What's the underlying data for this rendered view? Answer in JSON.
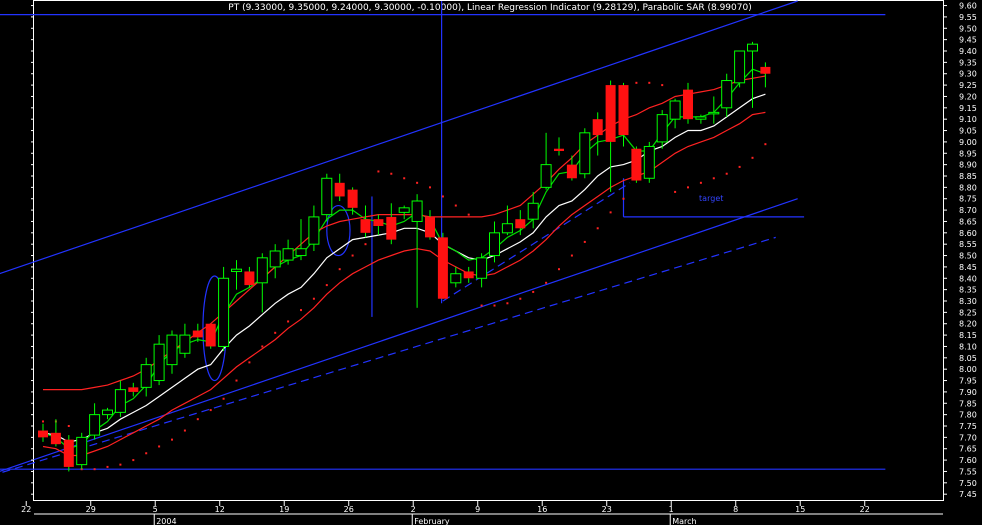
{
  "header": {
    "title": "PT (9.33000, 9.35000, 9.24000, 9.30000, -0.10000), Linear Regression Indicator (9.28129), Parabolic SAR (8.99070)"
  },
  "chart_data": {
    "type": "candlestick",
    "title": "PT (9.33000, 9.35000, 9.24000, 9.30000, -0.10000), Linear Regression Indicator (9.28129), Parabolic SAR (8.99070)",
    "ylim": [
      7.42,
      9.62
    ],
    "y_ticks": [
      "9.60",
      "9.55",
      "9.50",
      "9.45",
      "9.40",
      "9.35",
      "9.30",
      "9.25",
      "9.20",
      "9.15",
      "9.10",
      "9.05",
      "9.00",
      "8.95",
      "8.90",
      "8.85",
      "8.80",
      "8.75",
      "8.70",
      "8.65",
      "8.60",
      "8.55",
      "8.50",
      "8.45",
      "8.40",
      "8.35",
      "8.30",
      "8.25",
      "8.20",
      "8.15",
      "8.10",
      "8.05",
      "8.00",
      "7.95",
      "7.90",
      "7.85",
      "7.80",
      "7.75",
      "7.70",
      "7.65",
      "7.60",
      "7.55",
      "7.50",
      "7.45"
    ],
    "x_ticks": [
      "15",
      "22",
      "29",
      "5",
      "12",
      "19",
      "26",
      "2",
      "9",
      "16",
      "23",
      "1",
      "8",
      "15",
      "22"
    ],
    "x_tick_index": [
      -6.3,
      -1.3,
      3.7,
      8.7,
      13.7,
      18.7,
      23.7,
      28.7,
      33.7,
      38.7,
      43.7,
      48.7,
      53.7,
      58.7,
      63.7
    ],
    "x_months": [
      {
        "label": "2004",
        "index": 8.7
      },
      {
        "label": "February",
        "index": 28.7
      },
      {
        "label": "March",
        "index": 48.7
      }
    ],
    "x_range": [
      -7,
      65.3
    ],
    "colors": {
      "up": "#00ff00",
      "down": "#ff1111",
      "wick": "#00ff00",
      "ema_white": "#ffffff",
      "ema_green": "#00dd00",
      "envelope_red": "#ff2222",
      "sar": "#ff2222",
      "trendline": "#2233ff"
    },
    "candles": [
      {
        "o": 7.73,
        "h": 7.76,
        "l": 7.68,
        "c": 7.7
      },
      {
        "o": 7.72,
        "h": 7.78,
        "l": 7.66,
        "c": 7.67
      },
      {
        "o": 7.69,
        "h": 7.71,
        "l": 7.55,
        "c": 7.57
      },
      {
        "o": 7.58,
        "h": 7.72,
        "l": 7.56,
        "c": 7.7
      },
      {
        "o": 7.71,
        "h": 7.85,
        "l": 7.69,
        "c": 7.8
      },
      {
        "o": 7.8,
        "h": 7.83,
        "l": 7.78,
        "c": 7.82
      },
      {
        "o": 7.81,
        "h": 7.95,
        "l": 7.79,
        "c": 7.91
      },
      {
        "o": 7.92,
        "h": 7.94,
        "l": 7.88,
        "c": 7.9
      },
      {
        "o": 7.92,
        "h": 8.05,
        "l": 7.88,
        "c": 8.02
      },
      {
        "o": 7.95,
        "h": 8.15,
        "l": 7.93,
        "c": 8.11
      },
      {
        "o": 8.02,
        "h": 8.17,
        "l": 7.98,
        "c": 8.15
      },
      {
        "o": 8.07,
        "h": 8.2,
        "l": 8.05,
        "c": 8.15
      },
      {
        "o": 8.17,
        "h": 8.2,
        "l": 8.12,
        "c": 8.14
      },
      {
        "o": 8.2,
        "h": 8.19,
        "l": 8.09,
        "c": 8.1
      },
      {
        "o": 8.1,
        "h": 8.45,
        "l": 8.08,
        "c": 8.4
      },
      {
        "o": 8.43,
        "h": 8.48,
        "l": 8.35,
        "c": 8.44
      },
      {
        "o": 8.43,
        "h": 8.45,
        "l": 8.36,
        "c": 8.37
      },
      {
        "o": 8.38,
        "h": 8.51,
        "l": 8.25,
        "c": 8.49
      },
      {
        "o": 8.45,
        "h": 8.55,
        "l": 8.4,
        "c": 8.52
      },
      {
        "o": 8.48,
        "h": 8.57,
        "l": 8.46,
        "c": 8.53
      },
      {
        "o": 8.5,
        "h": 8.66,
        "l": 8.48,
        "c": 8.53
      },
      {
        "o": 8.55,
        "h": 8.72,
        "l": 8.52,
        "c": 8.67
      },
      {
        "o": 8.68,
        "h": 8.86,
        "l": 8.65,
        "c": 8.84
      },
      {
        "o": 8.82,
        "h": 8.86,
        "l": 8.74,
        "c": 8.76
      },
      {
        "o": 8.79,
        "h": 8.8,
        "l": 8.68,
        "c": 8.71
      },
      {
        "o": 8.66,
        "h": 8.72,
        "l": 8.58,
        "c": 8.6
      },
      {
        "o": 8.66,
        "h": 8.68,
        "l": 8.59,
        "c": 8.63
      },
      {
        "o": 8.67,
        "h": 8.73,
        "l": 8.55,
        "c": 8.57
      },
      {
        "o": 8.69,
        "h": 8.72,
        "l": 8.66,
        "c": 8.71
      },
      {
        "o": 8.65,
        "h": 8.77,
        "l": 8.27,
        "c": 8.74
      },
      {
        "o": 8.67,
        "h": 8.7,
        "l": 8.57,
        "c": 8.58
      },
      {
        "o": 8.58,
        "h": 8.6,
        "l": 8.31,
        "c": 8.31
      },
      {
        "o": 8.38,
        "h": 8.45,
        "l": 8.36,
        "c": 8.42
      },
      {
        "o": 8.43,
        "h": 8.45,
        "l": 8.38,
        "c": 8.4
      },
      {
        "o": 8.4,
        "h": 8.51,
        "l": 8.36,
        "c": 8.49
      },
      {
        "o": 8.5,
        "h": 8.65,
        "l": 8.47,
        "c": 8.6
      },
      {
        "o": 8.6,
        "h": 8.72,
        "l": 8.59,
        "c": 8.64
      },
      {
        "o": 8.66,
        "h": 8.7,
        "l": 8.59,
        "c": 8.62
      },
      {
        "o": 8.66,
        "h": 8.78,
        "l": 8.62,
        "c": 8.73
      },
      {
        "o": 8.8,
        "h": 9.04,
        "l": 8.79,
        "c": 8.9
      },
      {
        "o": 8.97,
        "h": 9.02,
        "l": 8.94,
        "c": 8.96
      },
      {
        "o": 8.9,
        "h": 8.94,
        "l": 8.83,
        "c": 8.84
      },
      {
        "o": 8.86,
        "h": 9.06,
        "l": 8.84,
        "c": 9.04
      },
      {
        "o": 9.1,
        "h": 9.13,
        "l": 8.94,
        "c": 9.03
      },
      {
        "o": 9.25,
        "h": 9.27,
        "l": 8.78,
        "c": 9.0
      },
      {
        "o": 9.25,
        "h": 9.26,
        "l": 8.98,
        "c": 9.03
      },
      {
        "o": 8.97,
        "h": 8.98,
        "l": 8.82,
        "c": 8.83
      },
      {
        "o": 8.84,
        "h": 9.0,
        "l": 8.82,
        "c": 8.98
      },
      {
        "o": 9.0,
        "h": 9.14,
        "l": 8.97,
        "c": 9.12
      },
      {
        "o": 9.1,
        "h": 9.19,
        "l": 9.06,
        "c": 9.18
      },
      {
        "o": 9.23,
        "h": 9.26,
        "l": 9.08,
        "c": 9.1
      },
      {
        "o": 9.1,
        "h": 9.12,
        "l": 9.08,
        "c": 9.11
      },
      {
        "o": 9.13,
        "h": 9.2,
        "l": 9.08,
        "c": 9.13
      },
      {
        "o": 9.15,
        "h": 9.3,
        "l": 9.11,
        "c": 9.27
      },
      {
        "o": 9.26,
        "h": 9.4,
        "l": 9.24,
        "c": 9.4
      },
      {
        "o": 9.4,
        "h": 9.44,
        "l": 9.15,
        "c": 9.43
      },
      {
        "o": 9.33,
        "h": 9.35,
        "l": 9.24,
        "c": 9.3
      }
    ],
    "series": [
      {
        "type": "line",
        "color_key": "ema_white",
        "values": [
          7.72,
          7.71,
          7.68,
          7.69,
          7.72,
          7.74,
          7.78,
          7.81,
          7.84,
          7.88,
          7.92,
          7.96,
          8.0,
          8.02,
          8.09,
          8.15,
          8.19,
          8.24,
          8.29,
          8.33,
          8.36,
          8.42,
          8.49,
          8.53,
          8.57,
          8.58,
          8.59,
          8.6,
          8.62,
          8.62,
          8.6,
          8.55,
          8.52,
          8.49,
          8.48,
          8.5,
          8.53,
          8.56,
          8.6,
          8.67,
          8.72,
          8.74,
          8.79,
          8.85,
          8.89,
          8.9,
          8.92,
          8.96,
          8.98,
          9.02,
          9.05,
          9.05,
          9.07,
          9.11,
          9.15,
          9.19,
          9.21
        ]
      },
      {
        "type": "line",
        "color_key": "ema_green",
        "values": [
          7.72,
          7.7,
          7.65,
          7.67,
          7.73,
          7.77,
          7.84,
          7.87,
          7.93,
          8.02,
          8.08,
          8.11,
          8.13,
          8.12,
          8.24,
          8.33,
          8.36,
          8.4,
          8.45,
          8.48,
          8.5,
          8.57,
          8.66,
          8.7,
          8.7,
          8.66,
          8.65,
          8.63,
          8.65,
          8.69,
          8.66,
          8.55,
          8.52,
          8.48,
          8.49,
          8.53,
          8.58,
          8.61,
          8.66,
          8.78,
          8.86,
          8.87,
          8.95,
          9.0,
          9.01,
          9.03,
          8.96,
          8.96,
          9.04,
          9.11,
          9.11,
          9.11,
          9.13,
          9.19,
          9.26,
          9.32,
          9.3
        ]
      },
      {
        "type": "line",
        "color_key": "envelope_red",
        "values": [
          7.66,
          7.65,
          7.62,
          7.62,
          7.64,
          7.66,
          7.69,
          7.72,
          7.75,
          7.78,
          7.82,
          7.85,
          7.88,
          7.91,
          7.96,
          8.01,
          8.05,
          8.09,
          8.13,
          8.18,
          8.22,
          8.27,
          8.33,
          8.38,
          8.42,
          8.45,
          8.48,
          8.5,
          8.52,
          8.53,
          8.52,
          8.48,
          8.45,
          8.42,
          8.41,
          8.42,
          8.45,
          8.48,
          8.52,
          8.57,
          8.63,
          8.68,
          8.72,
          8.76,
          8.8,
          8.83,
          8.85,
          8.87,
          8.91,
          8.95,
          8.98,
          9.0,
          9.02,
          9.05,
          9.08,
          9.12,
          9.13
        ]
      },
      {
        "type": "line",
        "color_key": "envelope_red",
        "values": [
          7.91,
          7.91,
          7.91,
          7.91,
          7.92,
          7.93,
          7.95,
          7.97,
          8.0,
          8.04,
          8.08,
          8.12,
          8.16,
          8.2,
          8.25,
          8.3,
          8.35,
          8.4,
          8.45,
          8.5,
          8.55,
          8.6,
          8.63,
          8.65,
          8.66,
          8.67,
          8.68,
          8.68,
          8.68,
          8.68,
          8.67,
          8.67,
          8.67,
          8.67,
          8.67,
          8.68,
          8.7,
          8.72,
          8.77,
          8.82,
          8.88,
          8.93,
          8.99,
          9.03,
          9.07,
          9.1,
          9.12,
          9.15,
          9.17,
          9.2,
          9.21,
          9.22,
          9.23,
          9.25,
          9.27,
          9.28,
          9.29
        ]
      }
    ],
    "sar": [
      {
        "i": 0,
        "v": 7.77
      },
      {
        "i": 1,
        "v": 7.77
      },
      {
        "i": 2,
        "v": 7.75
      },
      {
        "i": 3,
        "v": 7.56
      },
      {
        "i": 4,
        "v": 7.56
      },
      {
        "i": 5,
        "v": 7.57
      },
      {
        "i": 6,
        "v": 7.58
      },
      {
        "i": 7,
        "v": 7.6
      },
      {
        "i": 8,
        "v": 7.63
      },
      {
        "i": 9,
        "v": 7.66
      },
      {
        "i": 10,
        "v": 7.69
      },
      {
        "i": 11,
        "v": 7.73
      },
      {
        "i": 12,
        "v": 7.78
      },
      {
        "i": 13,
        "v": 7.82
      },
      {
        "i": 14,
        "v": 7.87
      },
      {
        "i": 15,
        "v": 7.95
      },
      {
        "i": 16,
        "v": 8.03
      },
      {
        "i": 17,
        "v": 8.1
      },
      {
        "i": 18,
        "v": 8.16
      },
      {
        "i": 19,
        "v": 8.21
      },
      {
        "i": 20,
        "v": 8.26
      },
      {
        "i": 21,
        "v": 8.31
      },
      {
        "i": 22,
        "v": 8.37
      },
      {
        "i": 23,
        "v": 8.44
      },
      {
        "i": 24,
        "v": 8.5
      },
      {
        "i": 25,
        "v": 8.55
      },
      {
        "i": 26,
        "v": 8.87
      },
      {
        "i": 27,
        "v": 8.86
      },
      {
        "i": 28,
        "v": 8.84
      },
      {
        "i": 29,
        "v": 8.82
      },
      {
        "i": 30,
        "v": 8.8
      },
      {
        "i": 31,
        "v": 8.76
      },
      {
        "i": 32,
        "v": 8.72
      },
      {
        "i": 33,
        "v": 8.68
      },
      {
        "i": 34,
        "v": 8.28
      },
      {
        "i": 35,
        "v": 8.28
      },
      {
        "i": 36,
        "v": 8.29
      },
      {
        "i": 37,
        "v": 8.31
      },
      {
        "i": 38,
        "v": 8.34
      },
      {
        "i": 39,
        "v": 8.38
      },
      {
        "i": 40,
        "v": 8.44
      },
      {
        "i": 41,
        "v": 8.5
      },
      {
        "i": 42,
        "v": 8.56
      },
      {
        "i": 43,
        "v": 8.62
      },
      {
        "i": 44,
        "v": 8.69
      },
      {
        "i": 45,
        "v": 8.75
      },
      {
        "i": 46,
        "v": 9.26
      },
      {
        "i": 47,
        "v": 9.26
      },
      {
        "i": 48,
        "v": 9.25
      },
      {
        "i": 49,
        "v": 8.78
      },
      {
        "i": 50,
        "v": 8.8
      },
      {
        "i": 51,
        "v": 8.82
      },
      {
        "i": 52,
        "v": 8.84
      },
      {
        "i": 53,
        "v": 8.86
      },
      {
        "i": 54,
        "v": 8.89
      },
      {
        "i": 55,
        "v": 8.93
      },
      {
        "i": 56,
        "v": 8.99
      }
    ],
    "trendlines": [
      {
        "name": "channel-upper",
        "x1": -7,
        "y1": 8.35,
        "x2": 58.5,
        "y2": 9.62,
        "dash": false
      },
      {
        "name": "channel-lower",
        "x1": -7,
        "y1": 7.48,
        "x2": 58.5,
        "y2": 8.75,
        "dash": false
      },
      {
        "name": "channel-lower-dashed",
        "x1": -7,
        "y1": 7.48,
        "x2": 56.8,
        "y2": 8.58,
        "dash": true
      },
      {
        "name": "resistance-top",
        "x1": -7,
        "y1": 9.56,
        "x2": 65.3,
        "y2": 9.56,
        "dash": false
      },
      {
        "name": "support-bottom",
        "x1": -7,
        "y1": 7.56,
        "x2": 65.3,
        "y2": 7.56,
        "dash": false
      },
      {
        "name": "vertical-marker",
        "x1": 30.9,
        "y1": 9.62,
        "x2": 30.9,
        "y2": 8.29,
        "dash": false
      },
      {
        "name": "target-line",
        "x1": 45,
        "y1": 8.67,
        "x2": 59,
        "y2": 8.67,
        "dash": false
      },
      {
        "name": "target-drop",
        "x1": 45,
        "y1": 8.84,
        "x2": 45,
        "y2": 8.67,
        "dash": false
      },
      {
        "name": "small-support",
        "x1": 31,
        "y1": 8.3,
        "x2": 45.5,
        "y2": 8.82,
        "dash": true
      },
      {
        "name": "marker-line",
        "x1": 25.5,
        "y1": 8.76,
        "x2": 25.5,
        "y2": 8.23,
        "dash": false
      }
    ],
    "ellipses": [
      {
        "name": "ellipse-january",
        "cx": 13.3,
        "cy": 8.18,
        "rx": 0.9,
        "ry": 0.23
      },
      {
        "name": "ellipse-late-january",
        "cx": 22.9,
        "cy": 8.61,
        "rx": 0.9,
        "ry": 0.11
      }
    ],
    "annotations": [
      {
        "text": "target",
        "x": 51.8,
        "y": 8.74
      }
    ]
  }
}
